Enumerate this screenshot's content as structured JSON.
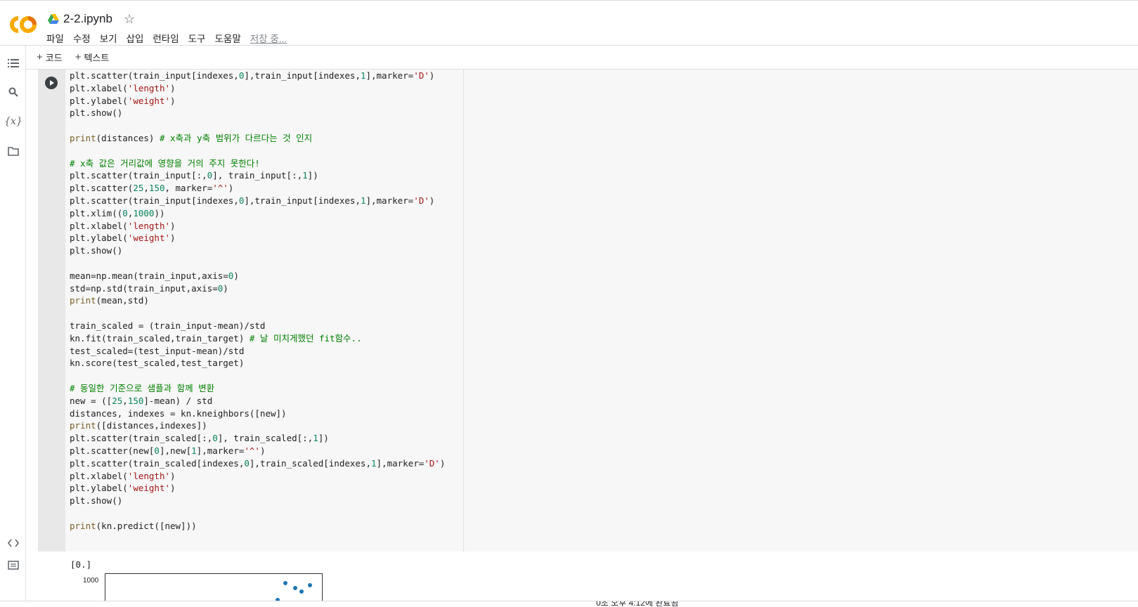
{
  "app": {
    "doc_title": "2-2.ipynb",
    "menu": [
      "파일",
      "수정",
      "보기",
      "삽입",
      "런타임",
      "도구",
      "도움말"
    ],
    "saving_status": "저장 중..."
  },
  "toolbar": {
    "add_code": "코드",
    "add_text": "텍스트"
  },
  "sidebar_icons": [
    "toc-icon",
    "search-icon",
    "variables-icon",
    "folder-icon",
    "code-snippets-icon",
    "terminal-icon"
  ],
  "code_lines": [
    [
      [
        "plt.scatter(train_input[indexes,",
        ""
      ],
      [
        "0",
        "num"
      ],
      [
        "],train_input[indexes,",
        ""
      ],
      [
        "1",
        "num"
      ],
      [
        "],marker=",
        ""
      ],
      [
        "'D'",
        "str"
      ],
      [
        ")",
        ""
      ]
    ],
    [
      [
        "plt.xlabel(",
        ""
      ],
      [
        "'length'",
        "str"
      ],
      [
        ")",
        ""
      ]
    ],
    [
      [
        "plt.ylabel(",
        ""
      ],
      [
        "'weight'",
        "str"
      ],
      [
        ")",
        ""
      ]
    ],
    [
      [
        "plt.show()",
        ""
      ]
    ],
    [],
    [
      [
        "print",
        "kw"
      ],
      [
        "(distances) ",
        ""
      ],
      [
        "# x축과 y축 범위가 다르다는 것 인지",
        "cmt"
      ]
    ],
    [],
    [
      [
        "# x축 값은 거리값에 영향을 거의 주지 못한다!",
        "cmt"
      ]
    ],
    [
      [
        "plt.scatter(train_input[:,",
        ""
      ],
      [
        "0",
        "num"
      ],
      [
        "], train_input[:,",
        ""
      ],
      [
        "1",
        "num"
      ],
      [
        "])",
        ""
      ]
    ],
    [
      [
        "plt.scatter(",
        ""
      ],
      [
        "25",
        "num"
      ],
      [
        ",",
        ""
      ],
      [
        "150",
        "num"
      ],
      [
        ", marker=",
        ""
      ],
      [
        "'^'",
        "str"
      ],
      [
        ")",
        ""
      ]
    ],
    [
      [
        "plt.scatter(train_input[indexes,",
        ""
      ],
      [
        "0",
        "num"
      ],
      [
        "],train_input[indexes,",
        ""
      ],
      [
        "1",
        "num"
      ],
      [
        "],marker=",
        ""
      ],
      [
        "'D'",
        "str"
      ],
      [
        ")",
        ""
      ]
    ],
    [
      [
        "plt.xlim((",
        ""
      ],
      [
        "0",
        "num"
      ],
      [
        ",",
        ""
      ],
      [
        "1000",
        "num"
      ],
      [
        "))",
        ""
      ]
    ],
    [
      [
        "plt.xlabel(",
        ""
      ],
      [
        "'length'",
        "str"
      ],
      [
        ")",
        ""
      ]
    ],
    [
      [
        "plt.ylabel(",
        ""
      ],
      [
        "'weight'",
        "str"
      ],
      [
        ")",
        ""
      ]
    ],
    [
      [
        "plt.show()",
        ""
      ]
    ],
    [],
    [
      [
        "mean=np.mean(train_input,axis=",
        ""
      ],
      [
        "0",
        "num"
      ],
      [
        ")",
        ""
      ]
    ],
    [
      [
        "std=np.std(train_input,axis=",
        ""
      ],
      [
        "0",
        "num"
      ],
      [
        ")",
        ""
      ]
    ],
    [
      [
        "print",
        "kw"
      ],
      [
        "(mean,std)",
        ""
      ]
    ],
    [],
    [
      [
        "train_scaled = (train_input-mean)/std",
        ""
      ]
    ],
    [
      [
        "kn.fit(train_scaled,train_target) ",
        ""
      ],
      [
        "# 날 미치게했던 fit함수..",
        "cmt"
      ]
    ],
    [
      [
        "test_scaled=(test_input-mean)/std",
        ""
      ]
    ],
    [
      [
        "kn.score(test_scaled,test_target)",
        ""
      ]
    ],
    [],
    [
      [
        "# 동일한 기준으로 샘플과 함께 변환",
        "cmt"
      ]
    ],
    [
      [
        "new = ([",
        ""
      ],
      [
        "25",
        "num"
      ],
      [
        ",",
        ""
      ],
      [
        "150",
        "num"
      ],
      [
        "]-mean) / std",
        ""
      ]
    ],
    [
      [
        "distances, indexes = kn.kneighbors([new])",
        ""
      ]
    ],
    [
      [
        "print",
        "kw"
      ],
      [
        "([distances,indexes])",
        ""
      ]
    ],
    [
      [
        "plt.scatter(train_scaled[:,",
        ""
      ],
      [
        "0",
        "num"
      ],
      [
        "], train_scaled[:,",
        ""
      ],
      [
        "1",
        "num"
      ],
      [
        "])",
        ""
      ]
    ],
    [
      [
        "plt.scatter(new[",
        ""
      ],
      [
        "0",
        "num"
      ],
      [
        "],new[",
        ""
      ],
      [
        "1",
        "num"
      ],
      [
        "],marker=",
        ""
      ],
      [
        "'^'",
        "str"
      ],
      [
        ")",
        ""
      ]
    ],
    [
      [
        "plt.scatter(train_scaled[indexes,",
        ""
      ],
      [
        "0",
        "num"
      ],
      [
        "],train_scaled[indexes,",
        ""
      ],
      [
        "1",
        "num"
      ],
      [
        "],marker=",
        ""
      ],
      [
        "'D'",
        "str"
      ],
      [
        ")",
        ""
      ]
    ],
    [
      [
        "plt.xlabel(",
        ""
      ],
      [
        "'length'",
        "str"
      ],
      [
        ")",
        ""
      ]
    ],
    [
      [
        "plt.ylabel(",
        ""
      ],
      [
        "'weight'",
        "str"
      ],
      [
        ")",
        ""
      ]
    ],
    [
      [
        "plt.show()",
        ""
      ]
    ],
    [],
    [
      [
        "print",
        "kw"
      ],
      [
        "(kn.predict([new]))",
        ""
      ]
    ]
  ],
  "output": {
    "text": "[0.]",
    "plot_y_tick": "1000"
  },
  "chart_data": {
    "type": "scatter",
    "ytick_labels": [
      "1000"
    ],
    "color": "#1f77b4"
  },
  "status": {
    "text": "0초   오후 4:12에 완료됨"
  }
}
